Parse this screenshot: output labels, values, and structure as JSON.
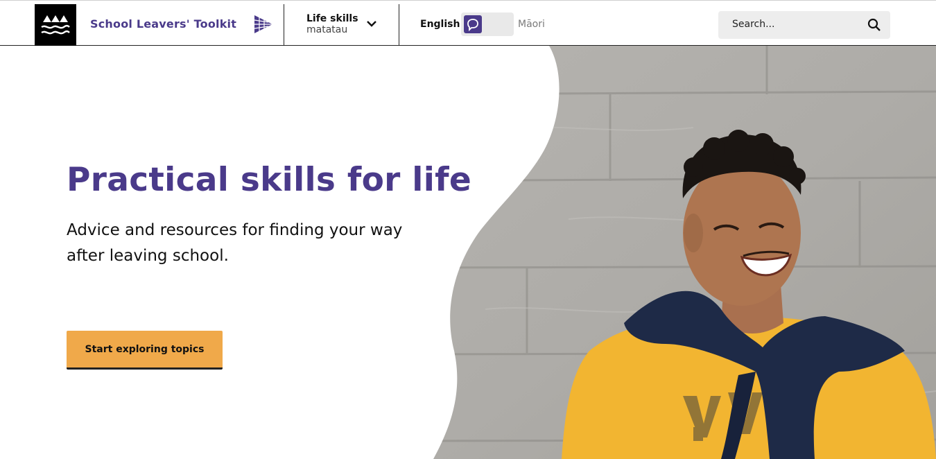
{
  "header": {
    "brand": "School Leavers' Toolkit",
    "section_title": "Life skills",
    "section_subtitle": "matatau",
    "lang_english": "English",
    "lang_maori": "Māori",
    "search_placeholder": "Search..."
  },
  "hero": {
    "title": "Practical skills for life",
    "subtitle": "Advice and resources for finding your way after leaving school.",
    "cta_label": "Start exploring topics"
  },
  "colors": {
    "brand_purple": "#4a3a8a",
    "cta_orange": "#f0a94a",
    "shirt_yellow": "#f2b531",
    "sweater_navy": "#1e2a47"
  },
  "icons": {
    "logo": "waves-mountains-logo-icon",
    "brand_arrow": "triangle-arrow-icon",
    "dropdown": "chevron-down-icon",
    "toggle": "speech-bubble-icon",
    "search": "search-icon"
  }
}
